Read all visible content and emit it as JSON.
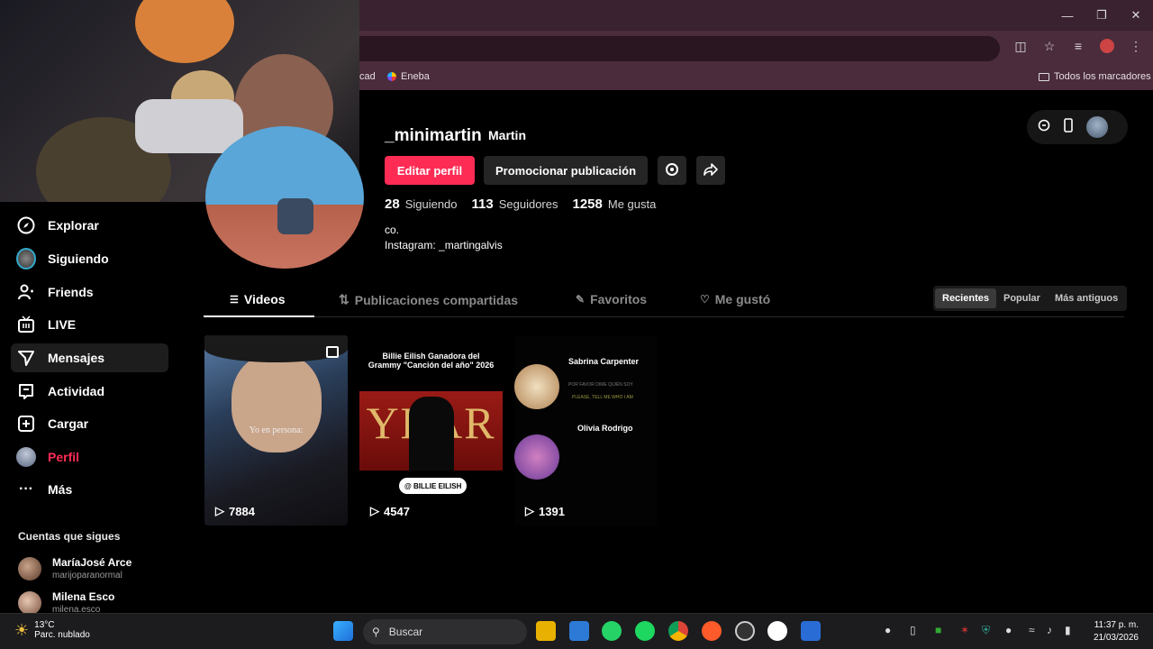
{
  "browser": {
    "bookmarks": [
      {
        "label": "cad"
      },
      {
        "label": "Eneba"
      }
    ],
    "all_bookmarks": "Todos los marcadores"
  },
  "sidebar": {
    "items": [
      {
        "label": "Explorar",
        "icon": "compass-icon"
      },
      {
        "label": "Siguiendo",
        "icon": "avatar-icon"
      },
      {
        "label": "Friends",
        "icon": "friends-icon"
      },
      {
        "label": "LIVE",
        "icon": "live-icon"
      },
      {
        "label": "Mensajes",
        "icon": "paper-plane-icon"
      },
      {
        "label": "Actividad",
        "icon": "inbox-icon"
      },
      {
        "label": "Cargar",
        "icon": "plus-square-icon"
      },
      {
        "label": "Perfil",
        "icon": "profile-avatar-icon"
      },
      {
        "label": "Más",
        "icon": "ellipsis-icon"
      }
    ],
    "following_title": "Cuentas que sigues",
    "accounts": [
      {
        "name": "MaríaJosé Arce",
        "handle": "marijoparanormal"
      },
      {
        "name": "Milena Esco",
        "handle": "milena.esco"
      }
    ]
  },
  "profile": {
    "username": "_minimartin",
    "display_name": "Martin",
    "edit_button": "Editar perfil",
    "promote_button": "Promocionar publicación",
    "stats": [
      {
        "value": "28",
        "label": "Siguiendo"
      },
      {
        "value": "113",
        "label": "Seguidores"
      },
      {
        "value": "1258",
        "label": "Me gusta"
      }
    ],
    "bio_line1": "co.",
    "bio_line2": "Instagram: _martingalvis"
  },
  "tabs": [
    {
      "label": "Videos",
      "icon": "grid-icon"
    },
    {
      "label": "Publicaciones compartidas",
      "icon": "repost-icon"
    },
    {
      "label": "Favoritos",
      "icon": "bookmark-icon"
    },
    {
      "label": "Me gustó",
      "icon": "heart-icon"
    }
  ],
  "sort": [
    "Recientes",
    "Popular",
    "Más antiguos"
  ],
  "videos": [
    {
      "views": "7884",
      "caption": "Yo en persona:"
    },
    {
      "views": "4547",
      "headline": "Billie Eilish Ganadora del Grammy \"Canción del año\" 2026",
      "big_word": "YEAR",
      "tag": "@ BILLIE EILISH"
    },
    {
      "views": "1391",
      "name1": "Sabrina Carpenter",
      "line1": "POR FAVOR DIME QUIÉN SOY",
      "line2": "PLEASE, TELL ME WHO I AM",
      "name2": "Olivia Rodrigo"
    }
  ],
  "taskbar": {
    "temp": "13°C",
    "weather": "Parc. nublado",
    "search": "Buscar",
    "time": "11:37 p. m.",
    "date": "21/03/2026"
  },
  "colors": {
    "accent": "#fe2c55",
    "chrome": "#4a2c3c"
  }
}
